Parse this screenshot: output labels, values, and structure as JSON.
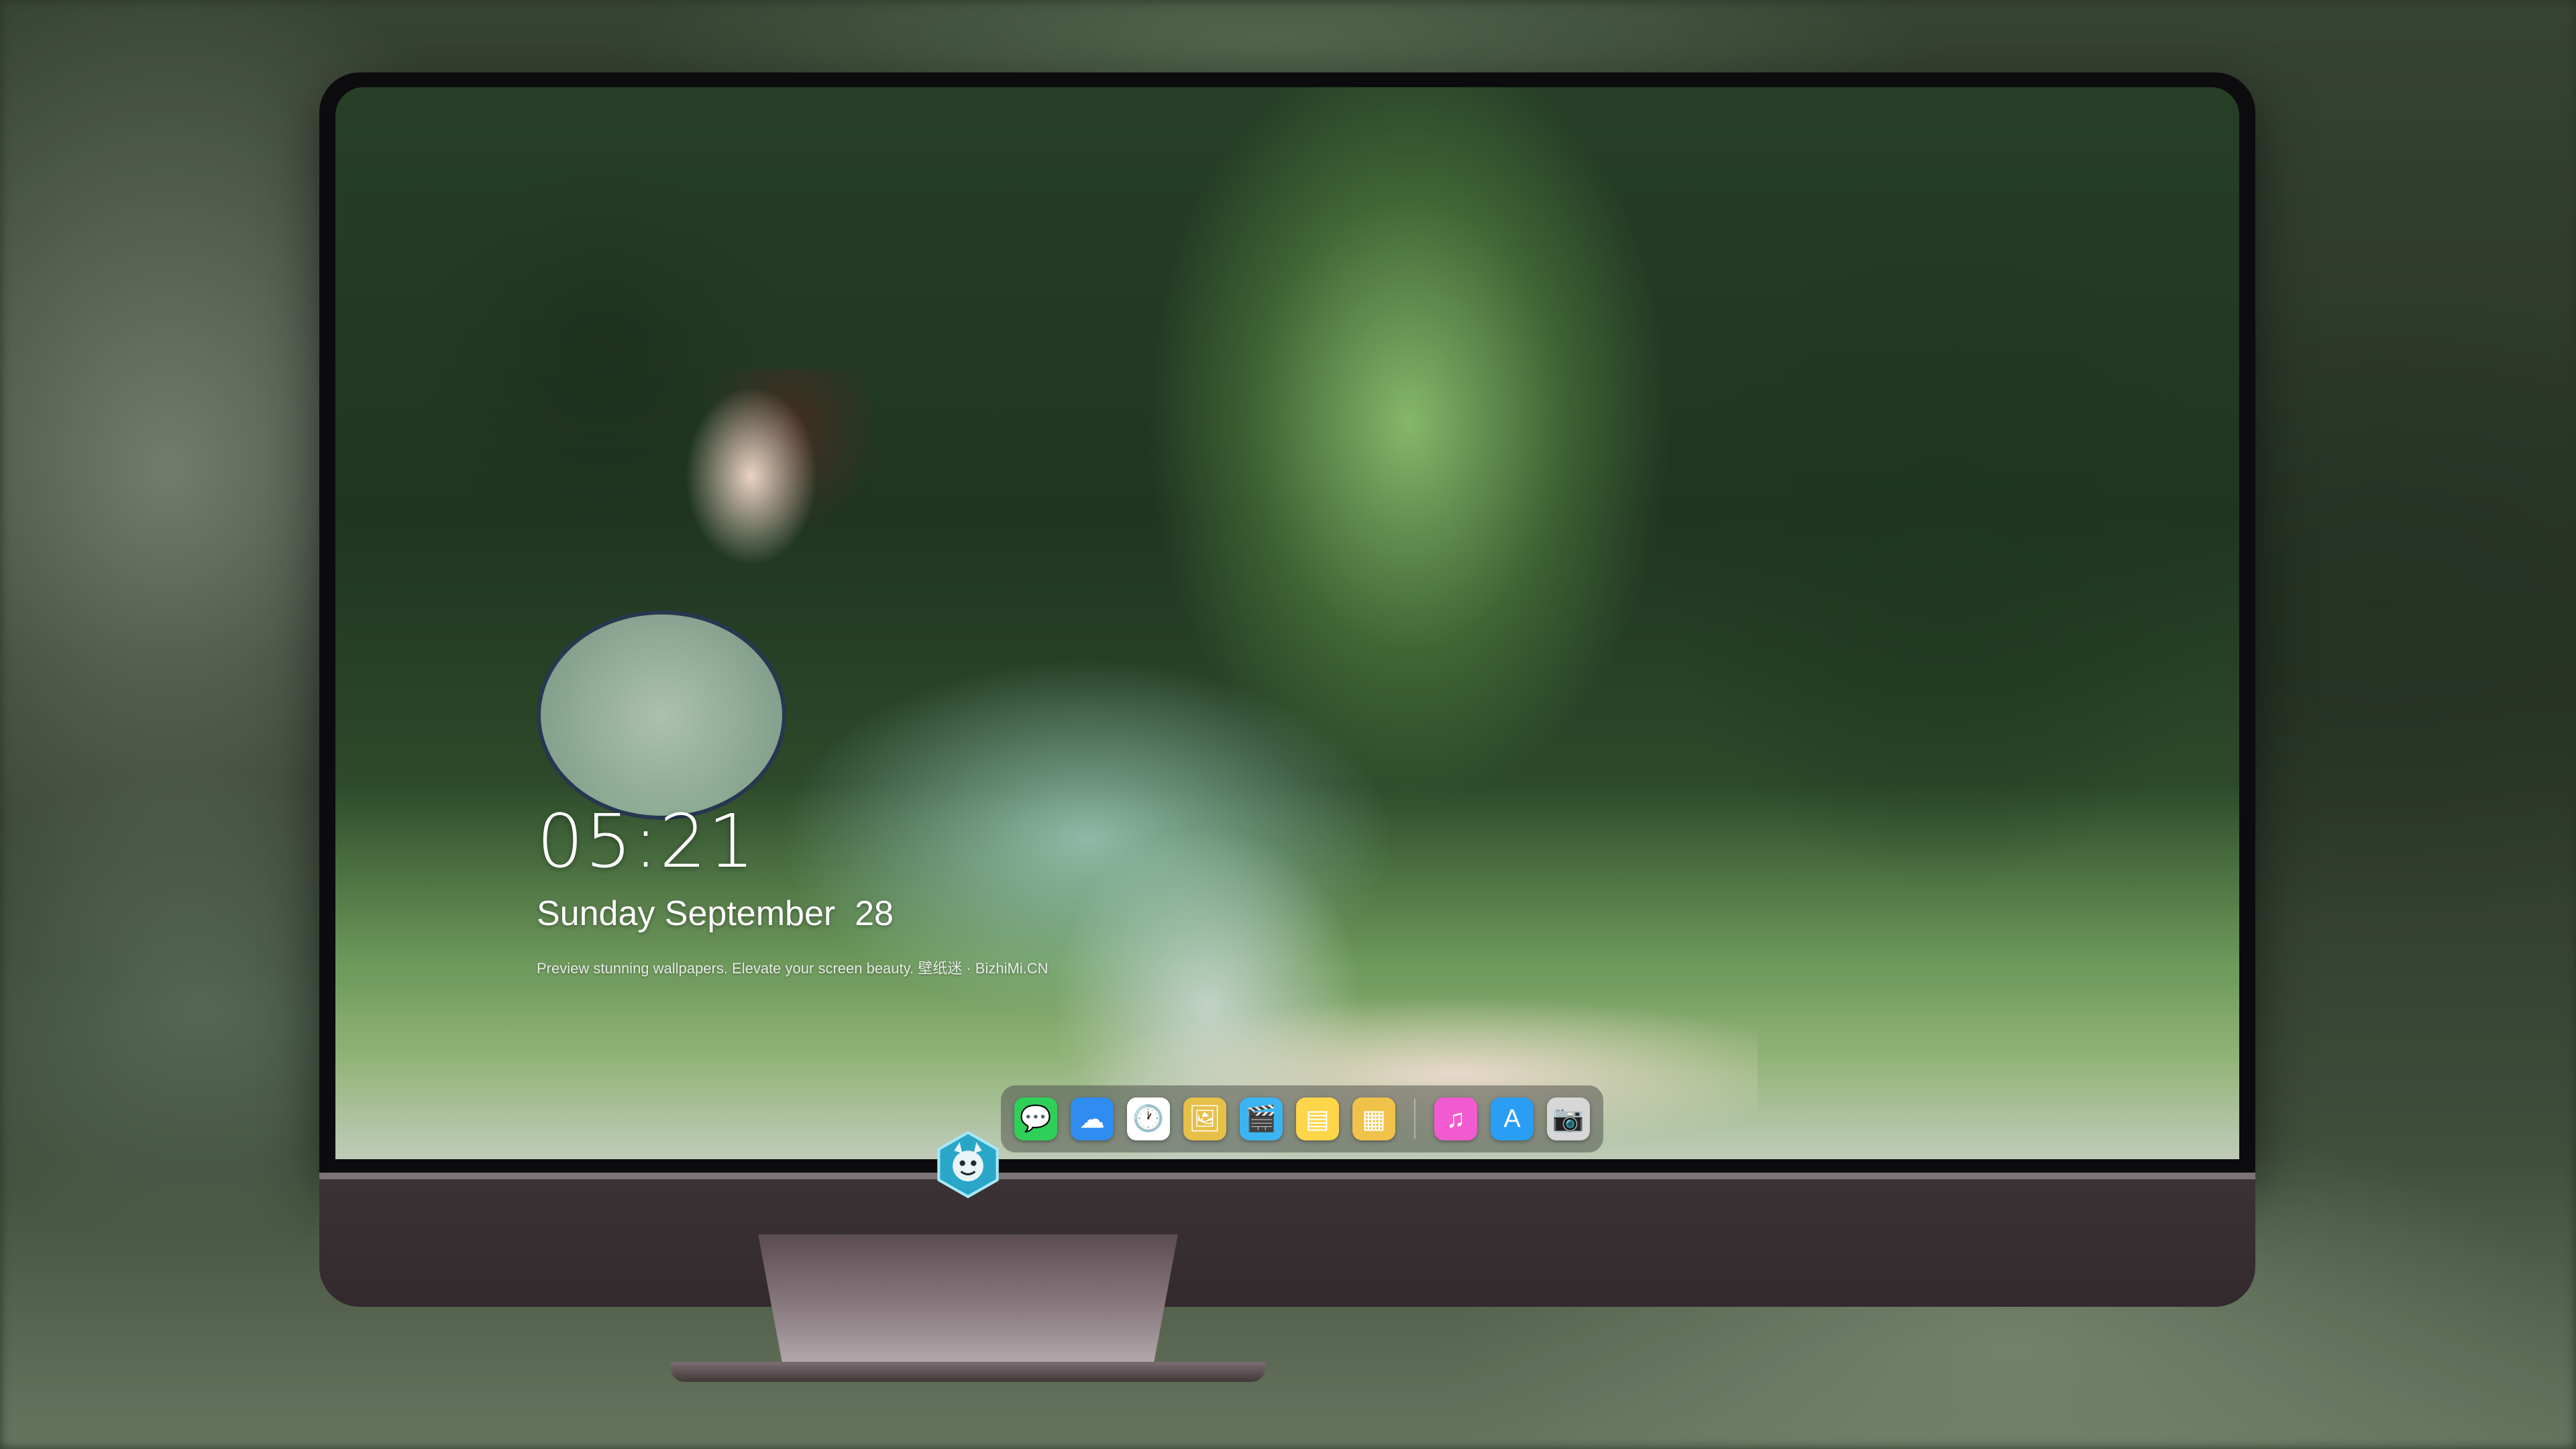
{
  "lockscreen": {
    "time": "05:21",
    "date": "Sunday September  28",
    "tagline": "Preview stunning wallpapers. Elevate your screen beauty. 壁纸迷 · BizhiMi.CN"
  },
  "dock": {
    "apps": [
      {
        "name": "messages-icon",
        "glyph": "💬",
        "color": "#2fd05a"
      },
      {
        "name": "weather-icon",
        "glyph": "☁",
        "color": "#2f8cf0"
      },
      {
        "name": "clock-icon",
        "glyph": "🕐",
        "color": "#ffffff"
      },
      {
        "name": "preview-icon",
        "glyph": "🖼",
        "color": "#e7c04a"
      },
      {
        "name": "clips-icon",
        "glyph": "🎬",
        "color": "#3bb5f2"
      },
      {
        "name": "notes-icon",
        "glyph": "▤",
        "color": "#ffd54a"
      },
      {
        "name": "photo-booth-icon",
        "glyph": "▦",
        "color": "#f0c24a"
      }
    ],
    "pinned": [
      {
        "name": "music-icon",
        "glyph": "♫",
        "color": "#f25bd0"
      },
      {
        "name": "app-store-icon",
        "glyph": "A",
        "color": "#2a9df4"
      },
      {
        "name": "camera-icon",
        "glyph": "📷",
        "color": "#d7d7d7"
      }
    ]
  },
  "monitor": {
    "brand_logo": "monitor-logo-icon"
  }
}
